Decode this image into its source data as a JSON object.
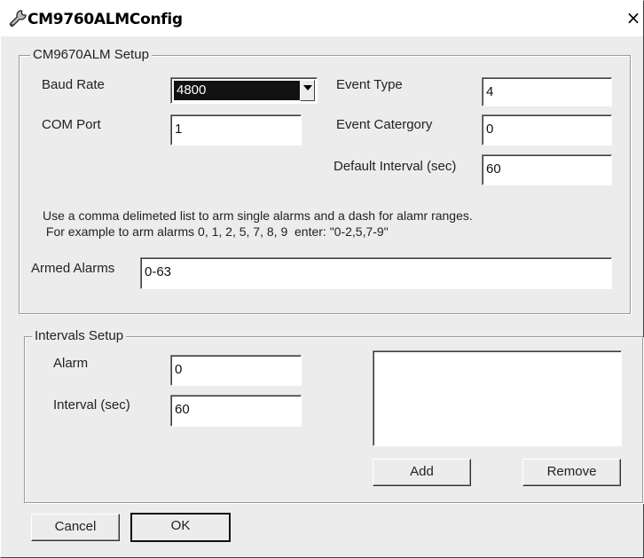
{
  "window": {
    "title": "CM9760ALMConfig",
    "close_glyph": "×"
  },
  "setup": {
    "legend": "CM9670ALM Setup",
    "baud_rate_label": "Baud Rate",
    "baud_rate_value": "4800",
    "com_port_label": "COM Port",
    "com_port_value": "1",
    "event_type_label": "Event Type",
    "event_type_value": "4",
    "event_category_label": "Event Catergory",
    "event_category_value": "0",
    "default_interval_label": "Default Interval (sec)",
    "default_interval_value": "60",
    "hint_line1": "Use a comma delimeted list to arm single alarms and a dash for alamr ranges.",
    "hint_line2": " For example to arm alarms 0, 1, 2, 5, 7, 8, 9  enter: \"0-2,5,7-9\"",
    "armed_alarms_label": "Armed Alarms",
    "armed_alarms_value": "0-63"
  },
  "intervals": {
    "legend": "Intervals Setup",
    "alarm_label": "Alarm",
    "alarm_value": "0",
    "interval_label": "Interval (sec)",
    "interval_value": "60",
    "list_items": [],
    "add_label": "Add",
    "remove_label": "Remove"
  },
  "footer": {
    "cancel_label": "Cancel",
    "ok_label": "OK"
  },
  "icons": {
    "title_icon": "wrench-icon",
    "close_icon": "close-icon",
    "dropdown_icon": "chevron-down-icon"
  }
}
